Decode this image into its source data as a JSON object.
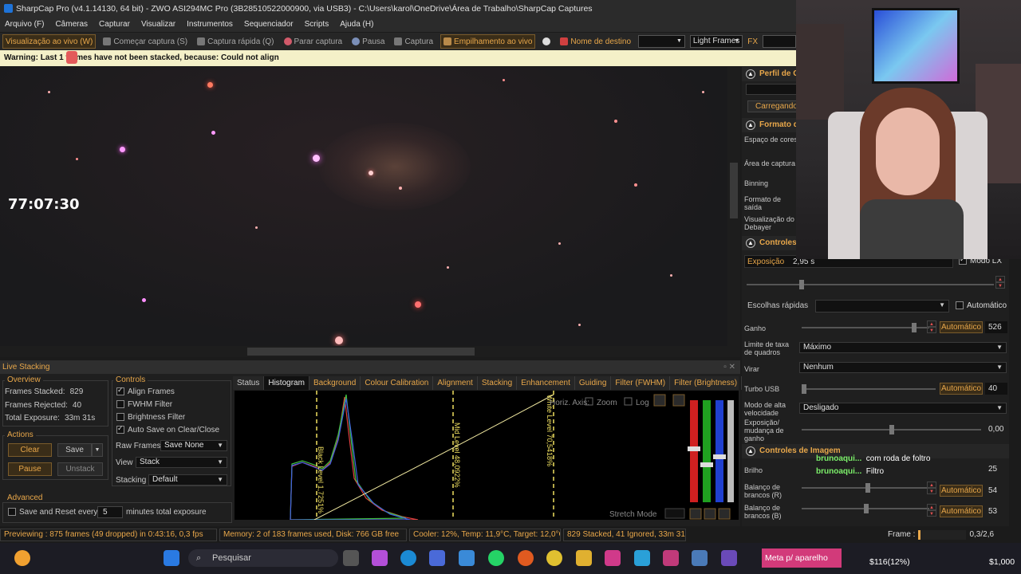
{
  "window": {
    "title": "SharpCap Pro (v4.1.14130, 64 bit) - ZWO ASI294MC Pro (3B28510522000900, via USB3) - C:\\Users\\karol\\OneDrive\\Área de Trabalho\\SharpCap Captures"
  },
  "menu": [
    "Arquivo (F)",
    "Câmeras",
    "Capturar",
    "Visualizar",
    "Instrumentos",
    "Sequenciador",
    "Scripts",
    "Ajuda (H)"
  ],
  "toolbar": {
    "live": "Visualização ao vivo (W)",
    "start_capture": "Começar captura (S)",
    "quick_capture": "Captura rápida (Q)",
    "stop_capture": "Parar captura",
    "pause": "Pausa",
    "capture": "Captura",
    "live_stack": "Empilhamento ao vivo",
    "target_name_label": "Nome de destino",
    "target_name_value": "",
    "frame_type": "Light Frames",
    "fx": "FX"
  },
  "warning": "Warning: Last 1 frames have not been stacked, because: Could not align",
  "overlay_timer": "77:07:30",
  "right_panel": {
    "profile_title": "Perfil de C",
    "loading": "Carregando",
    "format_title": "Formato d",
    "format_labels": [
      "Espaço de cores",
      "Área de captura",
      "Binning",
      "Formato de saída",
      "Visualização do Debayer"
    ],
    "controls_title": "Controles",
    "exposure_label": "Exposição",
    "exposure_value": "2,95 s",
    "lx_mode": "Modo LX",
    "quick_choices": "Escolhas rápidas",
    "automatic": "Automático",
    "gain_label": "Ganho",
    "gain_auto": "Automático",
    "gain_value": "526",
    "frame_limit_label": "Limite de taxa de quadros",
    "frame_limit_value": "Máximo",
    "flip_label": "Virar",
    "flip_value": "Nenhum",
    "turbo_label": "Turbo USB",
    "turbo_auto": "Automático",
    "turbo_value": "40",
    "highspeed_label": "Modo de alta velocidade",
    "highspeed_value": "Desligado",
    "exp_change_label": "Exposição/ mudança de ganho",
    "exp_change_value": "0,00",
    "image_controls_title": "Controles de Imagem",
    "brightness_label": "Brilho",
    "brightness_value": "25",
    "wb_r_label": "Balanço de brancos (R)",
    "wb_r_auto": "Automático",
    "wb_r_value": "54",
    "wb_b_label": "Balanço de brancos (B)",
    "wb_b_auto": "Automático",
    "wb_b_value": "53",
    "chat": [
      {
        "user": "bruno​aqui...",
        "msg": "com roda de foltro"
      },
      {
        "user": "brunoaqui...",
        "msg": "Filtro"
      }
    ]
  },
  "live_stacking": {
    "title": "Live Stacking",
    "overview_title": "Overview",
    "frames_stacked_label": "Frames Stacked:",
    "frames_stacked": "829",
    "frames_rejected_label": "Frames Rejected:",
    "frames_rejected": "40",
    "total_exposure_label": "Total Exposure:",
    "total_exposure": "33m 31s",
    "actions_title": "Actions",
    "clear": "Clear",
    "save": "Save",
    "pause": "Pause",
    "unstack": "Unstack",
    "advanced_title": "Advanced",
    "save_reset_label": "Save and Reset every",
    "save_reset_value": "5",
    "save_reset_suffix": "minutes total exposure",
    "controls_title": "Controls",
    "align_frames": "Align Frames",
    "fwhm_filter": "FWHM Filter",
    "brightness_filter": "Brightness Filter",
    "auto_save": "Auto Save on Clear/Close",
    "raw_frames_label": "Raw Frames",
    "raw_frames_value": "Save None",
    "view_label": "View",
    "view_value": "Stack",
    "stacking_label": "Stacking",
    "stacking_value": "Default",
    "tabs": [
      "Status",
      "Histogram",
      "Background",
      "Colour Calibration",
      "Alignment",
      "Stacking",
      "Enhancement",
      "Guiding",
      "Filter (FWHM)",
      "Filter (Brightness)"
    ],
    "active_tab": "Histogram",
    "hist_axis": "Horiz. Axis:",
    "zoom": "Zoom",
    "log": "Log",
    "black_level": "Black Level 1,7251%",
    "mid_level": "Mid Level 48,0922%",
    "white_level": "White Level 70,5418%",
    "stretch_mode": "Stretch Mode"
  },
  "status_bar": [
    "Previewing : 875 frames (49 dropped) in 0:43:16, 0,3 fps",
    "Memory: 2 of 183 frames used, Disk: 766 GB free",
    "Cooler: 12%, Temp: 11,9°C, Target: 12,0°C",
    "829 Stacked, 41 Ignored, 33m 31s"
  ],
  "frame_label": "Frame :",
  "frame_value": "0,3/2,6",
  "taskbar": {
    "search": "Pesquisar",
    "ticker": "Meta p/ aparelho",
    "stock1": "$116(12%)",
    "stock2": "$1,000"
  },
  "colors": {
    "accent": "#e8a74a",
    "warning_bg": "#f4f0c8",
    "panel_bg": "#1f1f1f"
  }
}
